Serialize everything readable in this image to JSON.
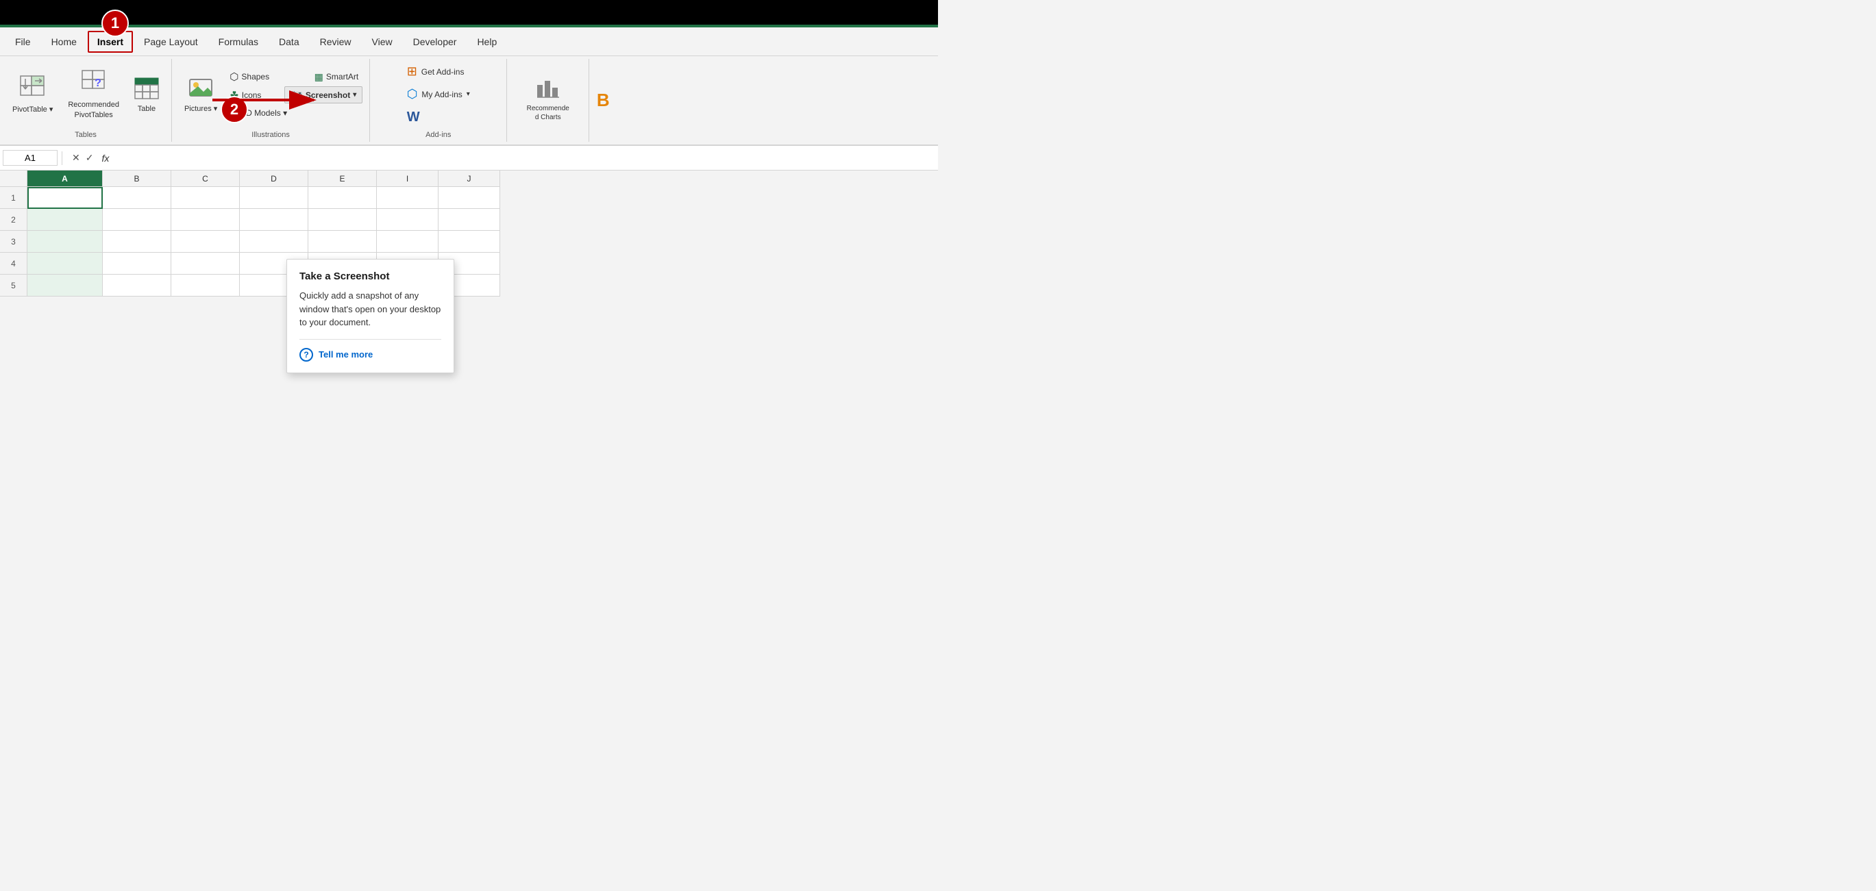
{
  "titlebar": {
    "bg": "#000000"
  },
  "step1": {
    "label": "1"
  },
  "step2": {
    "label": "2"
  },
  "greenbar": {
    "color": "#217346"
  },
  "ribbon": {
    "tabs": [
      {
        "id": "file",
        "label": "File",
        "active": false
      },
      {
        "id": "home",
        "label": "Home",
        "active": false
      },
      {
        "id": "insert",
        "label": "Insert",
        "active": true
      },
      {
        "id": "page-layout",
        "label": "Page Layout",
        "active": false
      },
      {
        "id": "formulas",
        "label": "Formulas",
        "active": false
      },
      {
        "id": "data",
        "label": "Data",
        "active": false
      },
      {
        "id": "review",
        "label": "Review",
        "active": false
      },
      {
        "id": "view",
        "label": "View",
        "active": false
      },
      {
        "id": "developer",
        "label": "Developer",
        "active": false
      },
      {
        "id": "help",
        "label": "Help",
        "active": false
      }
    ],
    "groups": {
      "tables": {
        "label": "Tables",
        "buttons": [
          {
            "id": "pivot-table",
            "label": "PivotTable",
            "sublabel": "▾"
          },
          {
            "id": "recommended-pivottables",
            "label": "Recommended\nPivotTables"
          },
          {
            "id": "table",
            "label": "Table"
          }
        ]
      },
      "illustrations": {
        "label": "Illustrations",
        "buttons": [
          {
            "id": "pictures",
            "label": "Pictures",
            "sublabel": "▾"
          },
          {
            "id": "shapes",
            "label": "Shapes"
          },
          {
            "id": "icons",
            "label": "Icons"
          },
          {
            "id": "3d-models",
            "label": "3D Models",
            "sublabel": "▾"
          },
          {
            "id": "smartart",
            "label": "SmartArt"
          },
          {
            "id": "screenshot",
            "label": "Screenshot",
            "sublabel": "▾",
            "highlighted": true
          }
        ]
      },
      "addins": {
        "label": "Add-ins",
        "buttons": [
          {
            "id": "get-addins",
            "label": "Get Add-ins"
          },
          {
            "id": "my-addins",
            "label": "My Add-ins",
            "sublabel": "▾"
          }
        ]
      },
      "charts": {
        "label": "",
        "buttons": [
          {
            "id": "recommended-charts",
            "label": "Recommende\nd Charts"
          }
        ]
      }
    }
  },
  "formulabar": {
    "cell_ref": "A1",
    "cancel_icon": "✕",
    "confirm_icon": "✓",
    "fx_label": "fx"
  },
  "grid": {
    "columns": [
      "A",
      "B",
      "C",
      "D",
      "E",
      "I",
      "J"
    ],
    "rows": [
      "1",
      "2",
      "3",
      "4",
      "5"
    ]
  },
  "tooltip": {
    "title": "Take a Screenshot",
    "description": "Quickly add a snapshot of any window that's open on your desktop to your document.",
    "link_text": "Tell me more"
  },
  "arrow": {
    "color": "#c00000"
  }
}
